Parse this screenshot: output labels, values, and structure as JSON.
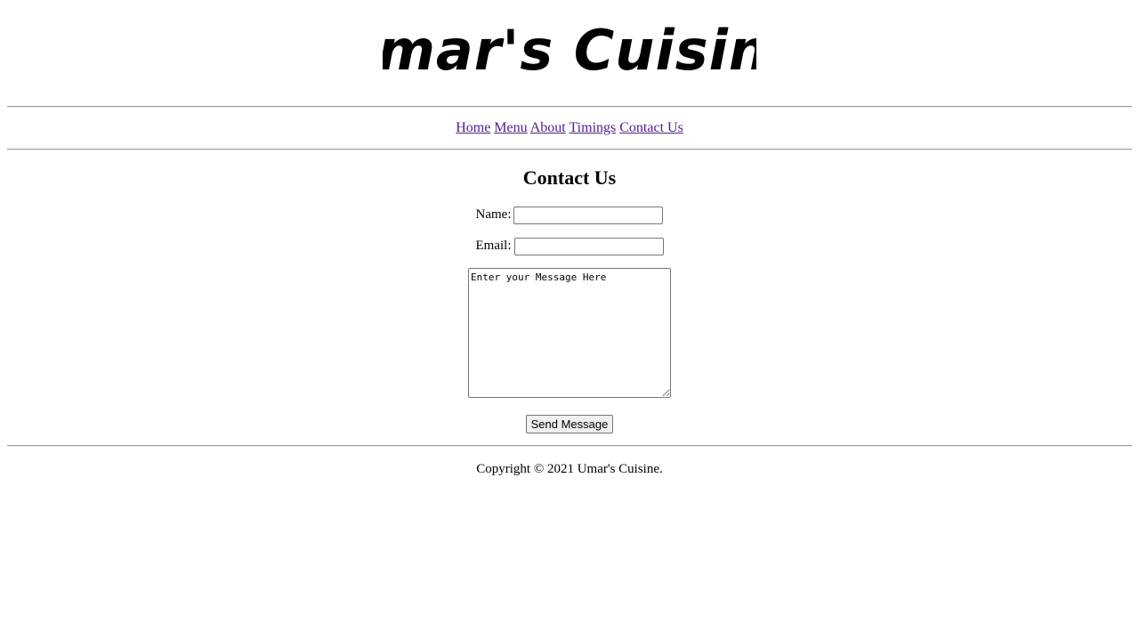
{
  "header": {
    "logo_text": "Umar's Cuisine"
  },
  "nav": {
    "items": [
      "Home",
      "Menu",
      "About",
      "Timings",
      "Contact Us"
    ]
  },
  "contact": {
    "title": "Contact Us",
    "name_label": "Name:",
    "name_value": "",
    "email_label": "Email:",
    "email_value": "",
    "message_placeholder": "Enter your Message Here",
    "send_label": "Send Message"
  },
  "footer": {
    "copyright": "Copyright © 2021 Umar's Cuisine."
  },
  "colors": {
    "link": "#551a8b",
    "rule": "#9a9a9a"
  }
}
